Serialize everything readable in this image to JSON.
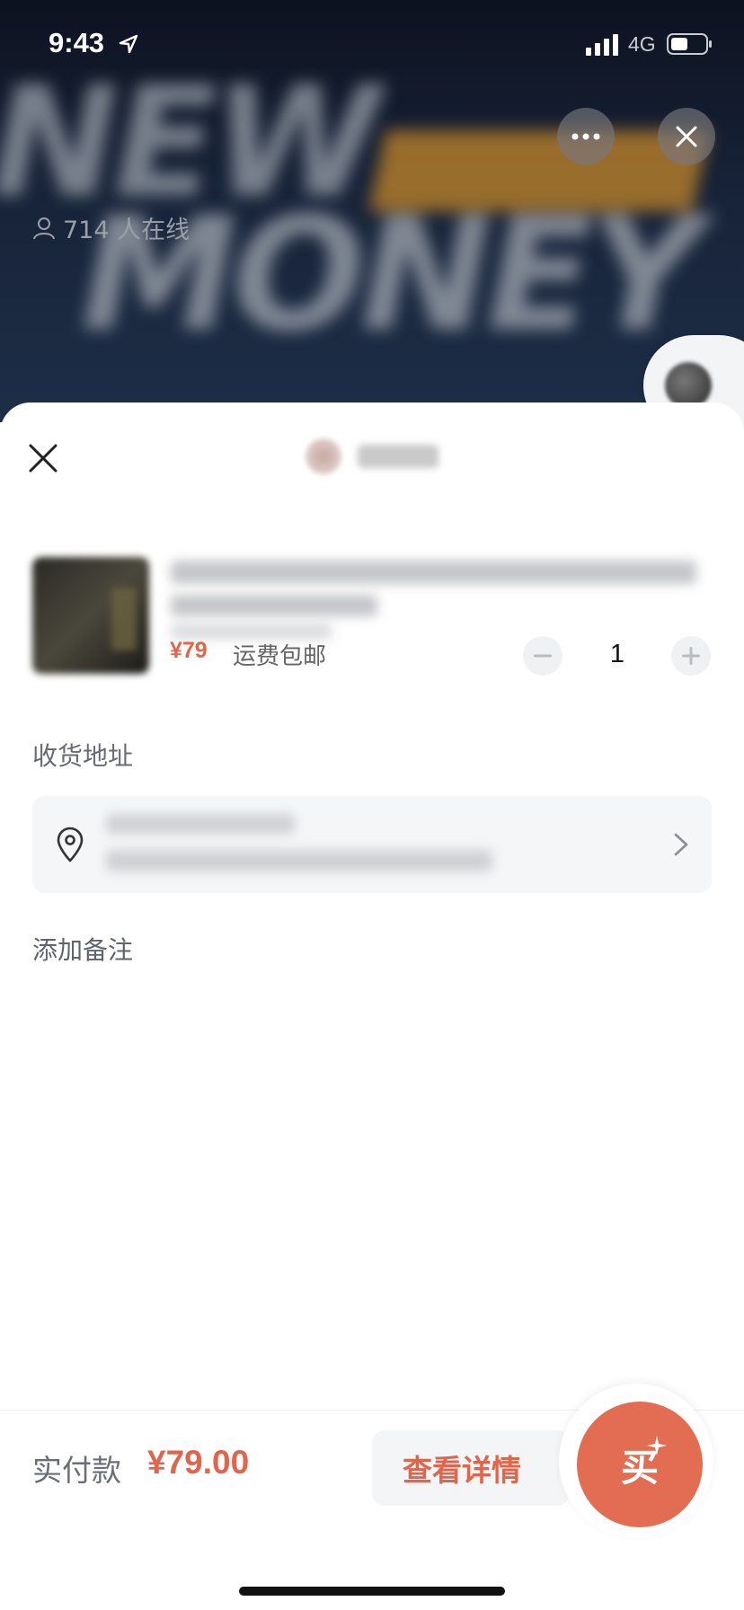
{
  "status_bar": {
    "time": "9:43",
    "network": "4G",
    "icons": [
      "location-arrow-icon",
      "signal-bars-icon",
      "battery-icon"
    ]
  },
  "live": {
    "viewers_text": "714 人在线",
    "viewer_icon": "person-icon",
    "actions": [
      "more-icon",
      "close-icon"
    ]
  },
  "sheet": {
    "close_icon": "close-icon",
    "product": {
      "price": "¥79",
      "shipping": "运费包邮",
      "quantity": "1",
      "minus_icon": "minus-icon",
      "plus_icon": "plus-icon"
    },
    "address": {
      "label": "收货地址",
      "pin_icon": "location-pin-icon",
      "chevron_icon": "chevron-right-icon"
    },
    "note_label": "添加备注"
  },
  "footer": {
    "paid_label": "实付款",
    "paid_amount": "¥79.00",
    "details_label": "查看详情",
    "buy_label": "买"
  },
  "colors": {
    "accent": "#e0654d",
    "buy_button": "#e36d53",
    "card_bg": "#f5f6f8"
  }
}
